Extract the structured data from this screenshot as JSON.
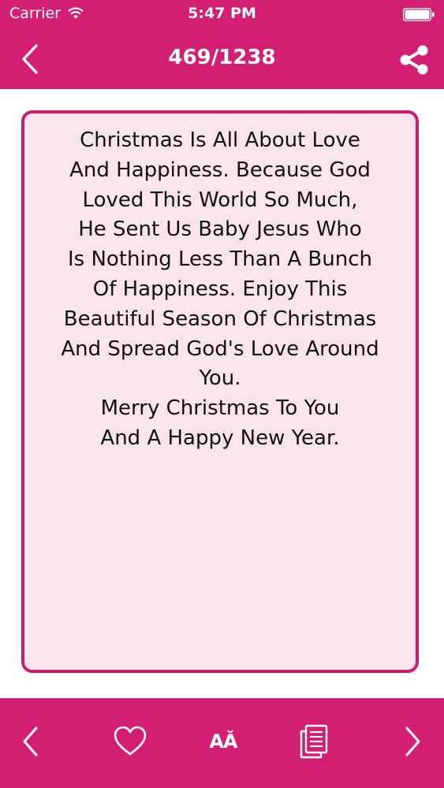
{
  "status_bar": {
    "carrier": "Carrier",
    "time": "5:47 PM"
  },
  "nav": {
    "title": "469/1238",
    "back_icon": "chevron-left-icon",
    "share_icon": "share-icon"
  },
  "quote": {
    "text": "Christmas Is All About Love\nAnd Happiness. Because God\nLoved This World So Much,\nHe Sent Us Baby Jesus Who\nIs Nothing Less Than A Bunch\nOf Happiness. Enjoy This\nBeautiful Season Of Christmas\nAnd Spread God's Love Around\nYou.\nMerry Christmas To You\nAnd A Happy New Year."
  },
  "toolbar": {
    "font_label": "AǍ",
    "items": [
      "previous-icon",
      "heart-icon",
      "font-size-icon",
      "copy-icon",
      "next-icon"
    ]
  },
  "colors": {
    "brand": "#d21f74",
    "card_border": "#c81c6c",
    "card_bg": "#f9e4ee",
    "text": "#111111"
  }
}
